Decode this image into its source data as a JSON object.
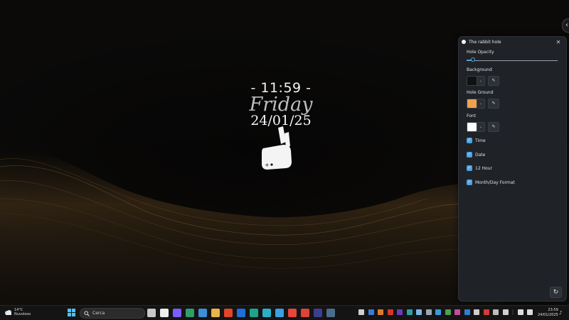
{
  "wallpaper": {
    "time": "- 11:59 -",
    "day": "Friday",
    "date": "24/01/25"
  },
  "panel": {
    "title": "The rabbit hole",
    "close_glyph": "✕",
    "hole_opacity_label": "Hole Opacity",
    "hole_opacity_value": 0.07,
    "background_label": "Background",
    "background_color": "#111111",
    "hole_ground_label": "Hole Ground",
    "hole_ground_color": "#f0a24e",
    "font_label": "Font",
    "font_color": "#ffffff",
    "checkboxes": [
      {
        "label": "Time",
        "checked": true
      },
      {
        "label": "Date",
        "checked": true
      },
      {
        "label": "12 Hour",
        "checked": true
      },
      {
        "label": "Month/Day Format",
        "checked": true
      }
    ],
    "reset_glyph": "↻",
    "eyedropper_glyph": "✎",
    "dropdown_glyph": "⌄",
    "check_glyph": "✓"
  },
  "taskbar": {
    "weather_temp": "14°C",
    "weather_desc": "Nuvoloso",
    "search_placeholder": "Cerca",
    "clock_time": "23:59",
    "clock_date": "24/01/2025",
    "accent": "#4cc2ff"
  }
}
